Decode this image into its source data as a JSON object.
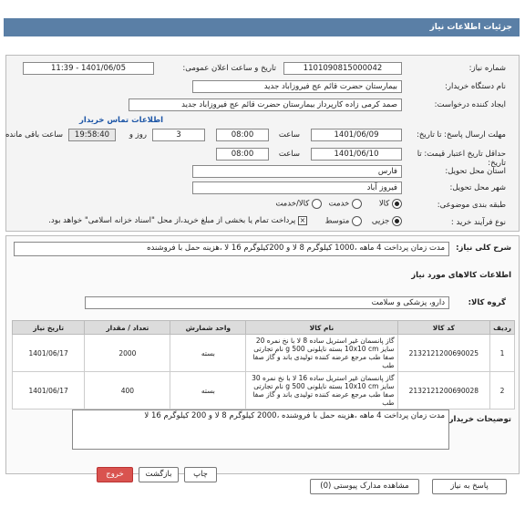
{
  "header": {
    "title": "جزئیات اطلاعات نیاز"
  },
  "need": {
    "number_label": "شماره نیاز:",
    "number": "1101090815000042",
    "announce_label": "تاریخ و ساعت اعلان عمومی:",
    "announce_value": "1401/06/05 - 11:39",
    "buyer_label": "نام دستگاه خریدار:",
    "buyer": "بیمارستان حضرت قائم  عج  فیروزاباد جدید",
    "creator_label": "ایجاد کننده درخواست:",
    "creator": "صمد کرمی زاده کارپرداز بیمارستان حضرت قائم  عج  فیروزاباد جدید",
    "contact_link": "اطلاعات تماس خریدار",
    "deadline_label": "مهلت ارسال پاسخ: تا تاریخ:",
    "deadline_date": "1401/06/09",
    "time_label": "ساعت",
    "deadline_time": "08:00",
    "days_value": "3",
    "days_label": "روز و",
    "remaining_time": "19:58:40",
    "remaining_label": "ساعت باقی مانده",
    "validity_label": "حداقل تاریخ اعتبار قیمت: تا تاریخ:",
    "validity_date": "1401/06/10",
    "validity_time_label": "ساعت",
    "validity_time": "08:00",
    "province_label": "استان محل تحویل:",
    "province": "فارس",
    "city_label": "شهر محل تحویل:",
    "city": "فیروز آباد",
    "category_label": "طبقه بندی موضوعی:",
    "category_options": [
      "کالا",
      "خدمت",
      "کالا/خدمت"
    ],
    "category_selected": "کالا",
    "process_label": "نوع فرآیند خرید :",
    "process_options": [
      "جزیی",
      "متوسط"
    ],
    "process_selected": "جزیی",
    "payment_note": "پرداخت تمام یا بخشی از مبلغ خرید،از محل \"اسناد خزانه اسلامی\" خواهد بود."
  },
  "general": {
    "desc_label": "شرح کلی نیاز:",
    "description": "مدت زمان پرداخت 4 ماهه ،1000 کیلوگرم 8 لا و 200کیلوگرم 16 لا ،هزینه حمل با فروشنده",
    "goods_title": "اطلاعات کالاهای مورد نیاز",
    "group_label": "گروه کالا:",
    "group_value": "دارو، پزشکی و سلامت"
  },
  "table": {
    "headers": [
      "ردیف",
      "کد کالا",
      "نام کالا",
      "واحد شمارش",
      "تعداد / مقدار",
      "تاریخ نیاز"
    ],
    "rows": [
      {
        "row": "1",
        "code": "2132121200690025",
        "name": "گاز پانسمان غیر استریل ساده 8 لا با نخ نمره 20 سایز 10x10 cm بسته نایلونی 500 g نام تجارتی صفا طب مرجع عرضه کننده تولیدی باند و گاز صفا طب",
        "unit": "بسته",
        "qty": "2000",
        "date": "1401/06/17"
      },
      {
        "row": "2",
        "code": "2132121200690028",
        "name": "گاز پانسمان غیر استریل ساده 16 لا با نخ نمره 30 سایز 10x10 cm بسته نایلونی 500 g نام تجارتی صفا طب مرجع عرضه کننده تولیدی باند و گاز صفا طب",
        "unit": "بسته",
        "qty": "400",
        "date": "1401/06/17"
      }
    ]
  },
  "buyer_notes": {
    "label": "توضیحات خریدار:",
    "text": "مدت زمان پرداخت 4 ماهه ،هزینه حمل با فروشنده ،2000 کیلوگرم 8 لا و 200 کیلوگرم 16 لا"
  },
  "footer": {
    "reply_button": "پاسخ به نیاز",
    "attachments_button": "مشاهده مدارک پیوستی (0)",
    "print_button": "چاپ",
    "back_button": "بازگشت",
    "exit_button": "خروج"
  },
  "colors": {
    "header_bg": "#5a7fa6",
    "exit_button": "#d9534f",
    "link": "#1c55a6"
  }
}
